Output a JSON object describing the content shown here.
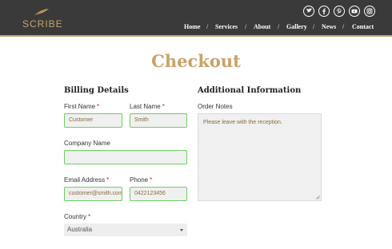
{
  "brand": {
    "name": "SCRIBE"
  },
  "social": [
    "twitter-icon",
    "facebook-icon",
    "pinterest-icon",
    "youtube-icon",
    "instagram-icon"
  ],
  "nav": {
    "items": [
      "Home",
      "Services",
      "About",
      "Gallery",
      "News",
      "Contact"
    ],
    "separator": "/"
  },
  "page": {
    "title": "Checkout"
  },
  "billing": {
    "heading": "Billing Details",
    "first_name": {
      "label": "First Name",
      "value": "Customer"
    },
    "last_name": {
      "label": "Last Name",
      "value": "Smith"
    },
    "company": {
      "label": "Company Name",
      "value": ""
    },
    "email": {
      "label": "Email Address",
      "value": "customer@smith.com"
    },
    "phone": {
      "label": "Phone",
      "value": "0422123456"
    },
    "country": {
      "label": "Country",
      "value": "Australia"
    },
    "required_mark": "*"
  },
  "additional": {
    "heading": "Additional Information",
    "order_notes": {
      "label": "Order Notes",
      "value": "Please leave with the reception."
    }
  },
  "colors": {
    "accent": "#c9a26a",
    "header_bg": "#3a3a3a",
    "valid_border": "#6ccf63",
    "required": "#cc2222"
  }
}
